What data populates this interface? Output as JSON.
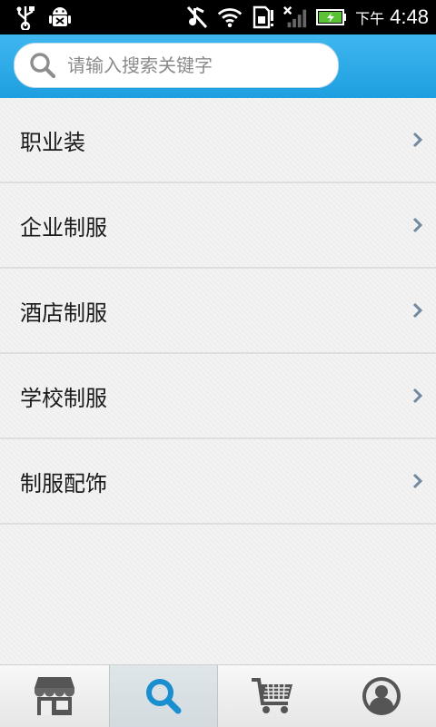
{
  "status_bar": {
    "ampm": "下午",
    "time": "4:48"
  },
  "search": {
    "placeholder": "请输入搜索关键字"
  },
  "categories": [
    {
      "label": "职业装"
    },
    {
      "label": "企业制服"
    },
    {
      "label": "酒店制服"
    },
    {
      "label": "学校制服"
    },
    {
      "label": "制服配饰"
    }
  ],
  "tabbar": {
    "active_tab": "search",
    "tabs": [
      {
        "icon": "store-icon"
      },
      {
        "icon": "search-icon"
      },
      {
        "icon": "cart-icon"
      },
      {
        "icon": "user-icon"
      }
    ]
  },
  "colors": {
    "header_blue": "#1e9fdf",
    "active_icon": "#1a8fd0",
    "inactive_icon": "#555555"
  }
}
